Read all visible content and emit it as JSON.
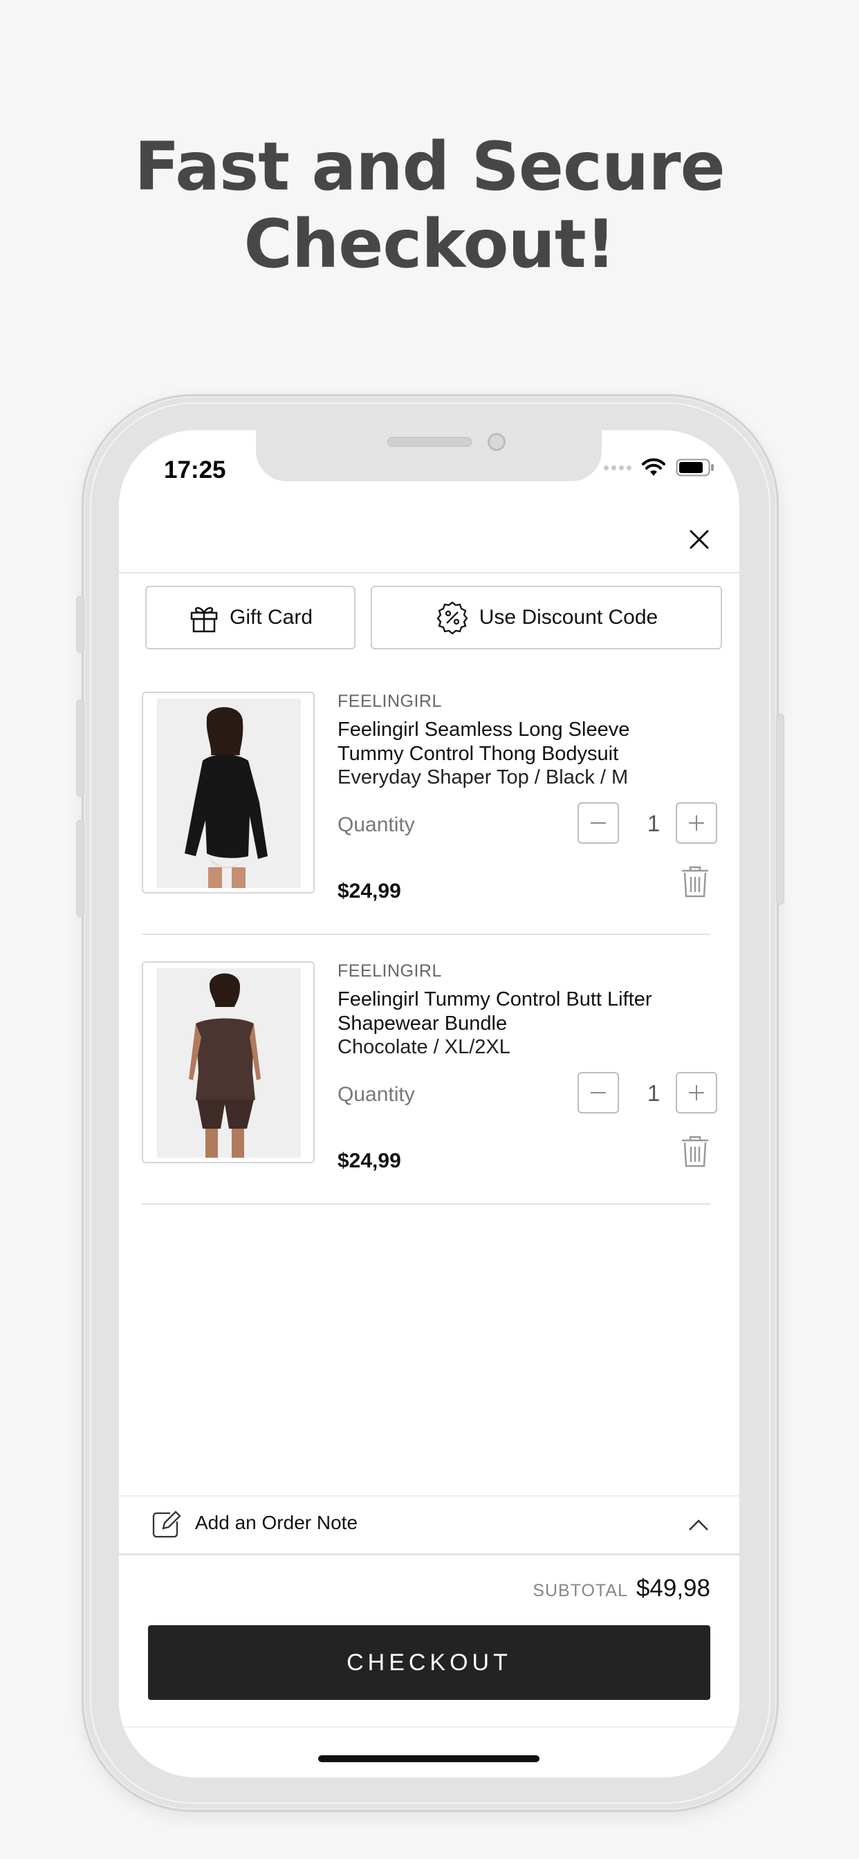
{
  "headline": {
    "line1": "Fast and Secure",
    "line2": "Checkout!"
  },
  "status_bar": {
    "time": "17:25"
  },
  "actions": {
    "gift_card": "Gift Card",
    "discount": "Use Discount Code"
  },
  "cart": {
    "items": [
      {
        "brand": "FEELINGIRL",
        "title": "Feelingirl Seamless Long Sleeve Tummy Control Thong Bodysuit",
        "variant": "Everyday Shaper Top / Black / M",
        "quantity_label": "Quantity",
        "quantity": "1",
        "price": "$24,99",
        "image_color": "#1a1a1a"
      },
      {
        "brand": "FEELINGIRL",
        "title": "Feelingirl Tummy Control Butt Lifter Shapewear Bundle",
        "variant": "Chocolate / XL/2XL",
        "quantity_label": "Quantity",
        "quantity": "1",
        "price": "$24,99",
        "image_color": "#4a3530"
      }
    ]
  },
  "order_note": {
    "label": "Add an Order Note"
  },
  "summary": {
    "subtotal_label": "SUBTOTAL",
    "subtotal_value": "$49,98"
  },
  "checkout": {
    "label": "CHECKOUT"
  },
  "colors": {
    "checkout_button": "#232323",
    "headline": "#474747"
  }
}
